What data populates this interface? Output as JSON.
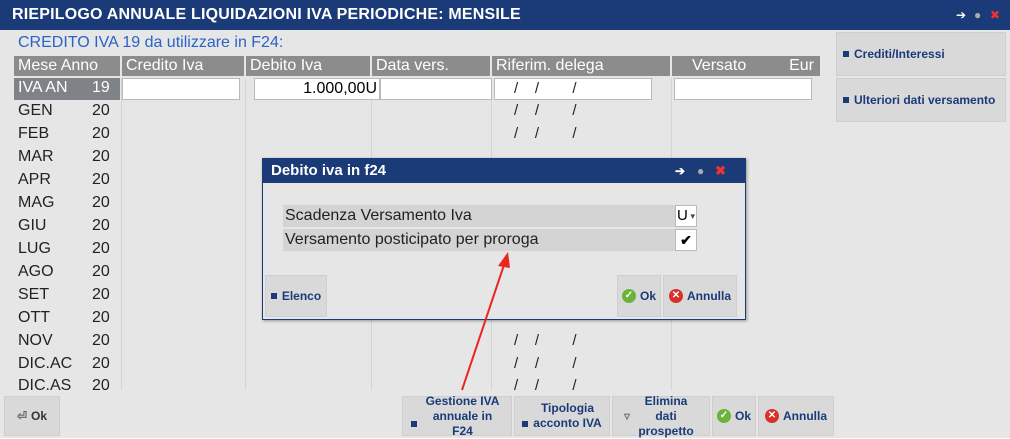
{
  "window": {
    "title": "RIEPILOGO ANNUALE LIQUIDAZIONI IVA PERIODICHE: MENSILE"
  },
  "main": {
    "subtitle": "CREDITO IVA 19 da utilizzare in F24:",
    "columns": [
      "Mese Anno",
      "Credito Iva",
      "Debito Iva",
      "Data vers.",
      "Riferim. delega",
      "Versato",
      "Eur"
    ],
    "first_row": {
      "label": "IVA AN",
      "year": "19",
      "debito": "1.000,00U"
    },
    "rows": [
      {
        "label": "GEN",
        "year": "20"
      },
      {
        "label": "FEB",
        "year": "20"
      },
      {
        "label": "MAR",
        "year": "20"
      },
      {
        "label": "APR",
        "year": "20"
      },
      {
        "label": "MAG",
        "year": "20"
      },
      {
        "label": "GIU",
        "year": "20"
      },
      {
        "label": "LUG",
        "year": "20"
      },
      {
        "label": "AGO",
        "year": "20"
      },
      {
        "label": "SET",
        "year": "20"
      },
      {
        "label": "OTT",
        "year": "20"
      },
      {
        "label": "NOV",
        "year": "20"
      },
      {
        "label": "DIC.AC",
        "year": "20"
      },
      {
        "label": "DIC.AS",
        "year": "20"
      }
    ],
    "delega_slashes": "/    /        /"
  },
  "sidebar": {
    "crediti": "Crediti/Interessi",
    "ulteriori": "Ulteriori dati versamento"
  },
  "bottom": {
    "ok": "Ok",
    "gestione": "Gestione IVA annuale in F24",
    "tipologia": "Tipologia acconto IVA",
    "elimina": "Elimina dati prospetto",
    "ok2": "Ok",
    "annulla": "Annulla"
  },
  "dialog": {
    "title": "Debito iva in f24",
    "field1": "Scadenza Versamento Iva",
    "field1_value": "U",
    "field2": "Versamento posticipato per proroga",
    "field2_checked": "✔",
    "elenco": "Elenco",
    "ok": "Ok",
    "annulla": "Annulla"
  },
  "colors": {
    "titlebar": "#1a3a78",
    "accent": "#2a63c7",
    "arrow": "#e8281e"
  }
}
